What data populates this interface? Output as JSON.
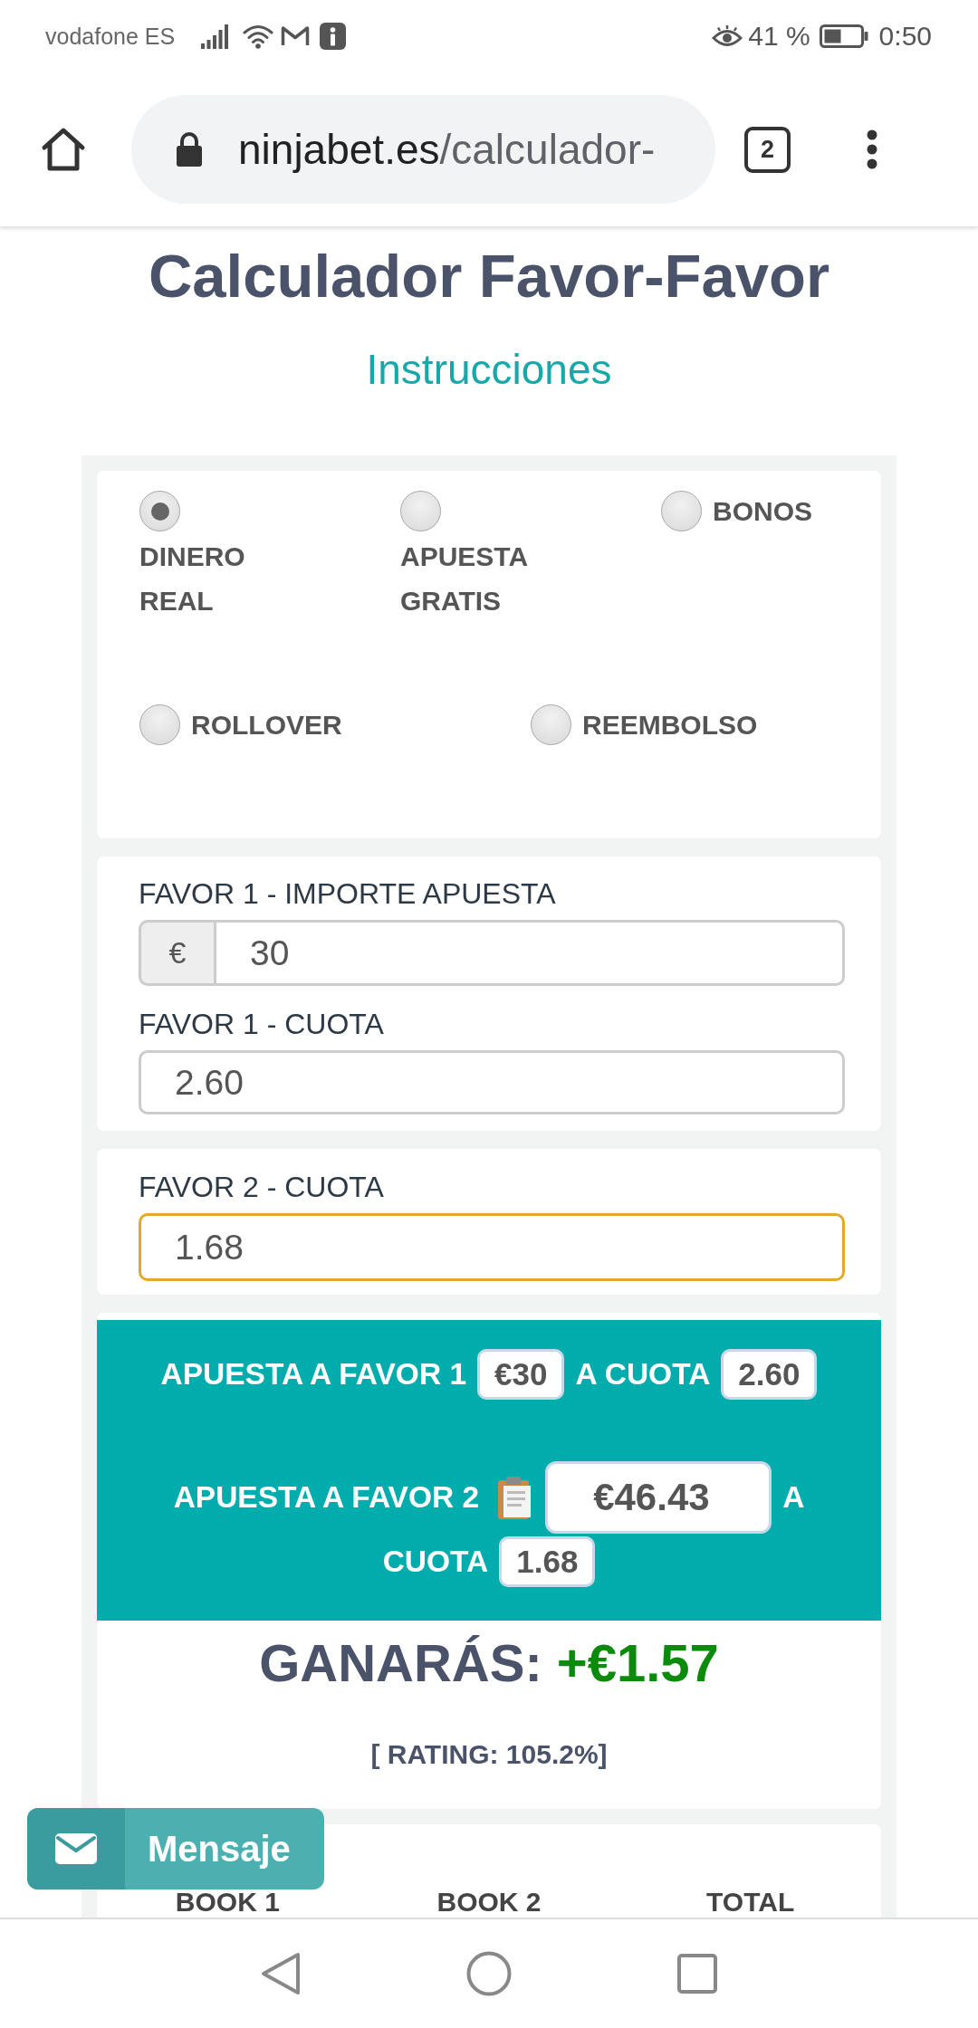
{
  "status_bar": {
    "carrier": "vodafone ES",
    "battery": "41 %",
    "time": "0:50"
  },
  "browser": {
    "url": {
      "host": "ninjabet.es",
      "path": "/calculador-"
    },
    "tab_count": "2"
  },
  "page": {
    "title": "Calculador Favor-Favor",
    "instructions_link": "Instrucciones"
  },
  "bet_types": {
    "rows": [
      {
        "options": [
          {
            "label": "DINERO REAL",
            "kind": "stacked",
            "selected": true
          },
          {
            "label": "APUESTA GRATIS",
            "kind": "stacked",
            "selected": false
          },
          {
            "label": "BONOS",
            "kind": "inline",
            "selected": false
          }
        ]
      },
      {
        "options": [
          {
            "label": "ROLLOVER",
            "kind": "inline",
            "selected": false
          },
          {
            "label": "REEMBOLSO",
            "kind": "inline",
            "selected": false
          }
        ]
      }
    ]
  },
  "inputs": [
    {
      "fields": [
        {
          "label": "FAVOR 1 - IMPORTE APUESTA",
          "prefix": "€",
          "value": "30",
          "focused": false
        },
        {
          "label": "FAVOR 1 - CUOTA",
          "value": "2.60",
          "focused": false
        }
      ]
    },
    {
      "fields": [
        {
          "label": "FAVOR 2 - CUOTA",
          "value": "1.68",
          "focused": true
        }
      ]
    }
  ],
  "summary": {
    "bets": [
      {
        "lines": [
          [
            {
              "kind": "text",
              "text": "APUESTA A FAVOR 1"
            },
            {
              "kind": "pill",
              "text": "€30"
            },
            {
              "kind": "text",
              "text": "A CUOTA"
            },
            {
              "kind": "pill",
              "text": "2.60"
            }
          ]
        ]
      },
      {
        "lines": [
          [
            {
              "kind": "text",
              "text": "APUESTA A FAVOR 2"
            },
            {
              "kind": "field",
              "value": "€46.43",
              "copyable": true
            },
            {
              "kind": "text",
              "text": "A"
            }
          ],
          [
            {
              "kind": "text",
              "text": "CUOTA"
            },
            {
              "kind": "pill",
              "text": "1.68"
            }
          ]
        ]
      }
    ],
    "profit_label": "GANARÁS:",
    "profit": "+€1.57",
    "rating": "[ RATING: 105.2%]"
  },
  "table": {
    "columns": [
      "BOOK 1",
      "BOOK 2",
      "TOTAL"
    ]
  },
  "message_button": {
    "label": "Mensaje"
  }
}
